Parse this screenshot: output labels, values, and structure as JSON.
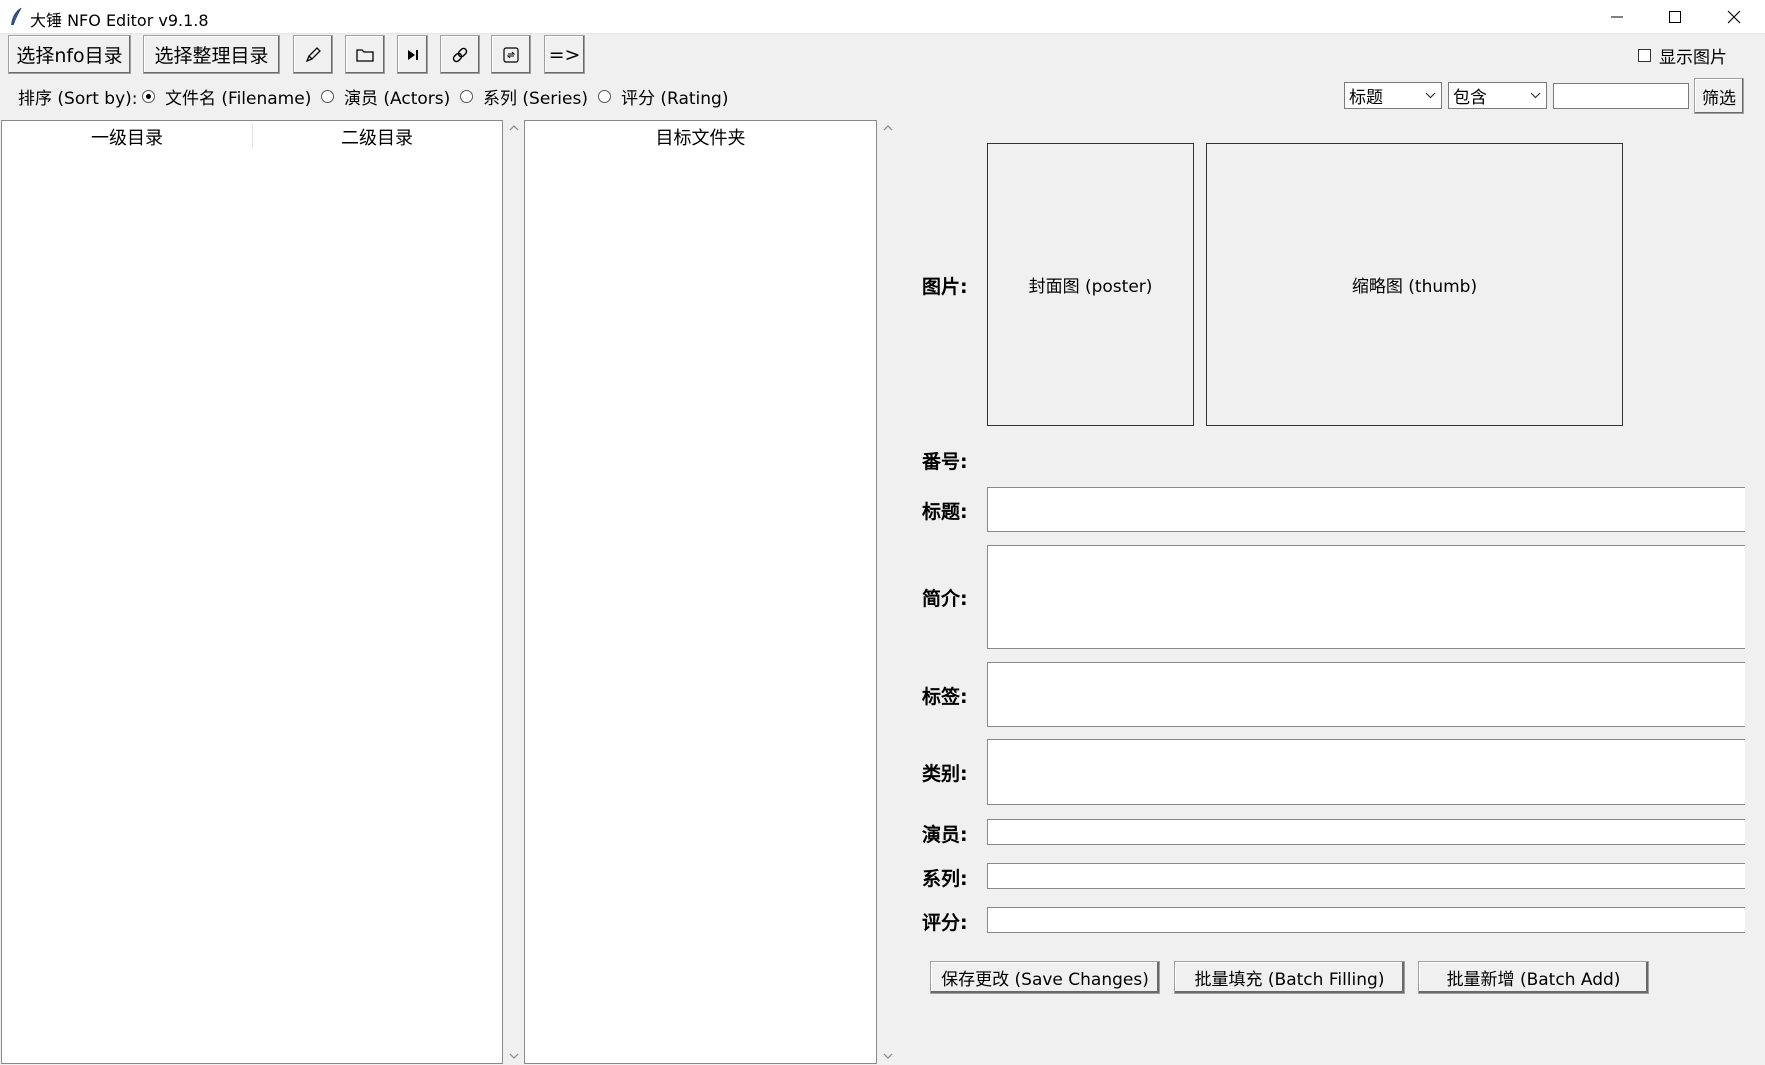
{
  "window": {
    "title": "大锤 NFO Editor v9.1.8",
    "controls": [
      "minimize-icon",
      "maximize-icon",
      "close-icon"
    ]
  },
  "toolbar": {
    "select_nfo_dir": "选择nfo目录",
    "select_organize_dir": "选择整理目录",
    "icons": [
      "pencil-icon",
      "folder-icon",
      "play-next-icon",
      "link-icon",
      "refresh-icon"
    ],
    "move_arrow": "=>",
    "show_images": "显示图片",
    "show_images_checked": false
  },
  "sort": {
    "label": "排序 (Sort by):",
    "options": [
      "文件名 (Filename)",
      "演员 (Actors)",
      "系列 (Series)",
      "评分 (Rating)"
    ],
    "selected": "文件名 (Filename)"
  },
  "filter": {
    "field": "标题",
    "condition": "包含",
    "value": "",
    "button": "筛选"
  },
  "tree": {
    "col1": "一级目录",
    "col2": "二级目录",
    "target_header": "目标文件夹"
  },
  "details": {
    "image_label": "图片:",
    "poster": "封面图 (poster)",
    "thumb": "缩略图 (thumb)",
    "num_label": "番号:",
    "title_label": "标题:",
    "plot_label": "简介:",
    "tags_label": "标签:",
    "genre_label": "类别:",
    "actors_label": "演员:",
    "series_label": "系列:",
    "rating_label": "评分:"
  },
  "actions": {
    "save": "保存更改 (Save Changes)",
    "batch_fill": "批量填充 (Batch Filling)",
    "batch_add": "批量新增 (Batch Add)"
  }
}
